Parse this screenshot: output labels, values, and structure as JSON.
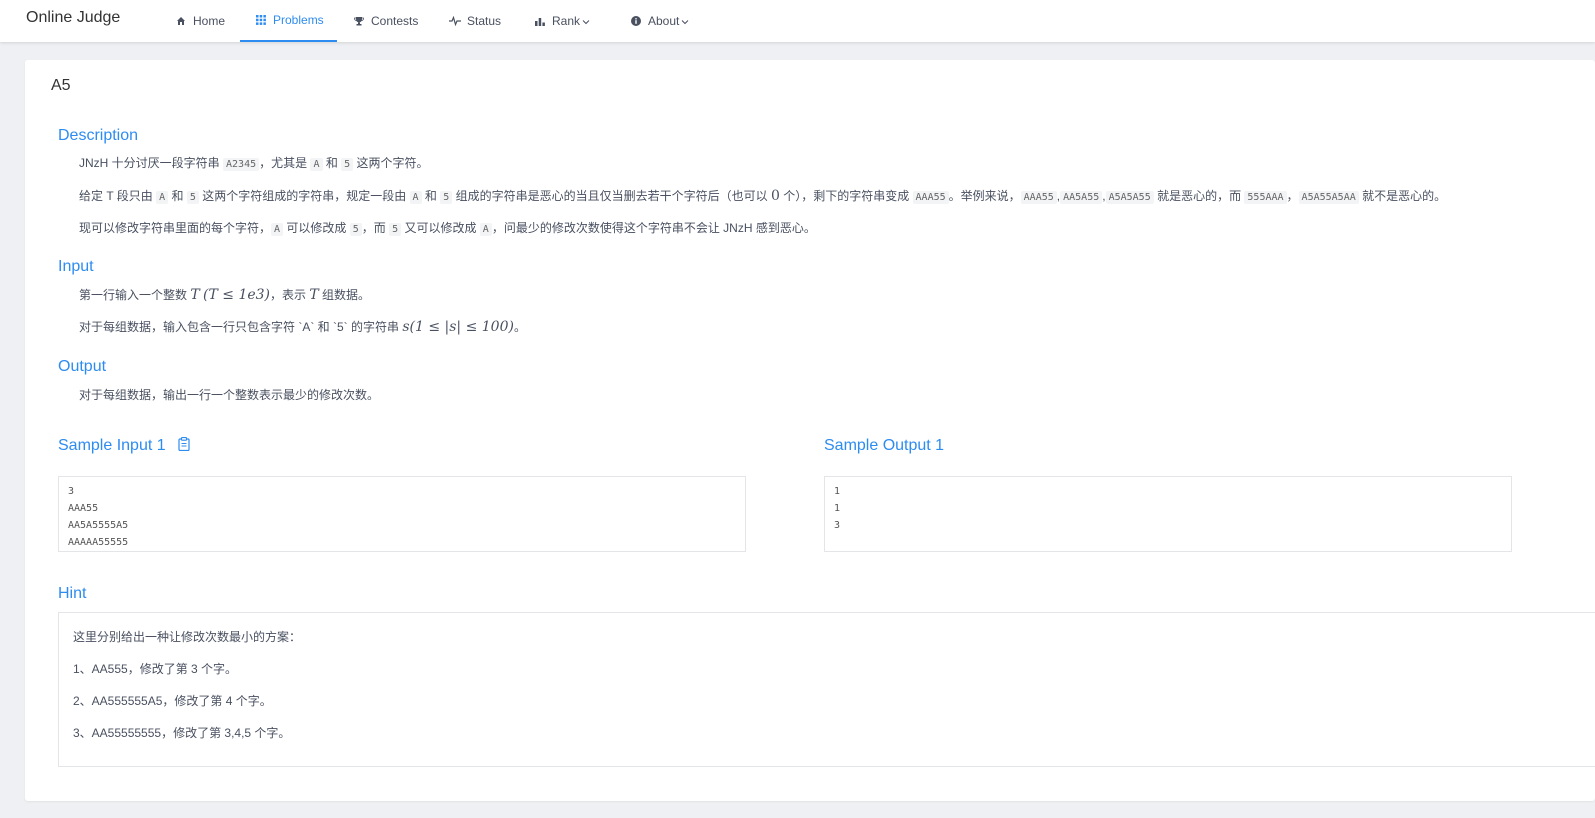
{
  "navbar": {
    "brand": "Online Judge",
    "items": [
      {
        "label": "Home",
        "icon": "home-icon"
      },
      {
        "label": "Problems",
        "icon": "grid-icon"
      },
      {
        "label": "Contests",
        "icon": "trophy-icon"
      },
      {
        "label": "Status",
        "icon": "pulse-icon"
      },
      {
        "label": "Rank",
        "icon": "bar-chart-icon"
      },
      {
        "label": "About",
        "icon": "info-icon"
      }
    ],
    "caret": "⌵"
  },
  "problem": {
    "title": "A5",
    "description_title": "Description",
    "desc1": {
      "a": "JNzH 十分讨厌一段字符串 ",
      "c1": "A2345",
      "b": "，尤其是 ",
      "c2": "A",
      "d": " 和 ",
      "c3": "5",
      "e": " 这两个字符。"
    },
    "desc2": {
      "a": "给定 T 段只由 ",
      "c1": "A",
      "b": " 和 ",
      "c2": "5",
      "c": " 这两个字符组成的字符串，规定一段由 ",
      "c3": "A",
      "d": " 和 ",
      "c4": "5",
      "e": " 组成的字符串是恶心的当且仅当删去若干个字符后（也可以 ",
      "zero": "0",
      "f": " 个），剩下的字符串变成 ",
      "c5": "AAA55",
      "g": "。举例来说，",
      "c6": "AAA55",
      "sep1": ",",
      "c7": "AA5A55",
      "sep2": ",",
      "c8": "A5A5A55",
      "h": " 就是恶心的，而 ",
      "c9": "555AAA",
      "i": "，",
      "c10": "A5A55A5AA",
      "j": " 就不是恶心的。"
    },
    "desc3": {
      "a": "现可以修改字符串里面的每个字符，",
      "c1": "A",
      "b": " 可以修改成 ",
      "c2": "5",
      "c": "，而 ",
      "c3": "5",
      "d": " 又可以修改成 ",
      "c4": "A",
      "e": "，问最少的修改次数使得这个字符串不会让 JNzH 感到恶心。"
    },
    "input_title": "Input",
    "input1": {
      "a": "第一行输入一个整数 ",
      "m1": "T",
      "m2": "(T ≤ 1e3)",
      "b": "，表示 ",
      "m3": "T",
      "c": " 组数据。"
    },
    "input2": {
      "a": "对于每组数据，输入包含一行只包含字符 `A` 和 `5` 的字符串 ",
      "m1": "s(1 ≤ |s| ≤ 100)",
      "b": "。"
    },
    "output_title": "Output",
    "output1": "对于每组数据，输出一行一个整数表示最少的修改次数。",
    "sample_input_title": "Sample Input 1",
    "sample_output_title": "Sample Output 1",
    "sample_input_lines": [
      "3",
      "AAA55",
      "AA5A5555A5",
      "AAAAA55555"
    ],
    "sample_output_lines": [
      "1",
      "1",
      "3"
    ],
    "hint_title": "Hint",
    "hint_lines": [
      "这里分别给出一种让修改次数最小的方案：",
      "1、AA555，修改了第 3 个字。",
      "2、AA555555A5，修改了第 4 个字。",
      "3、AA55555555，修改了第 3,4,5 个字。"
    ]
  }
}
